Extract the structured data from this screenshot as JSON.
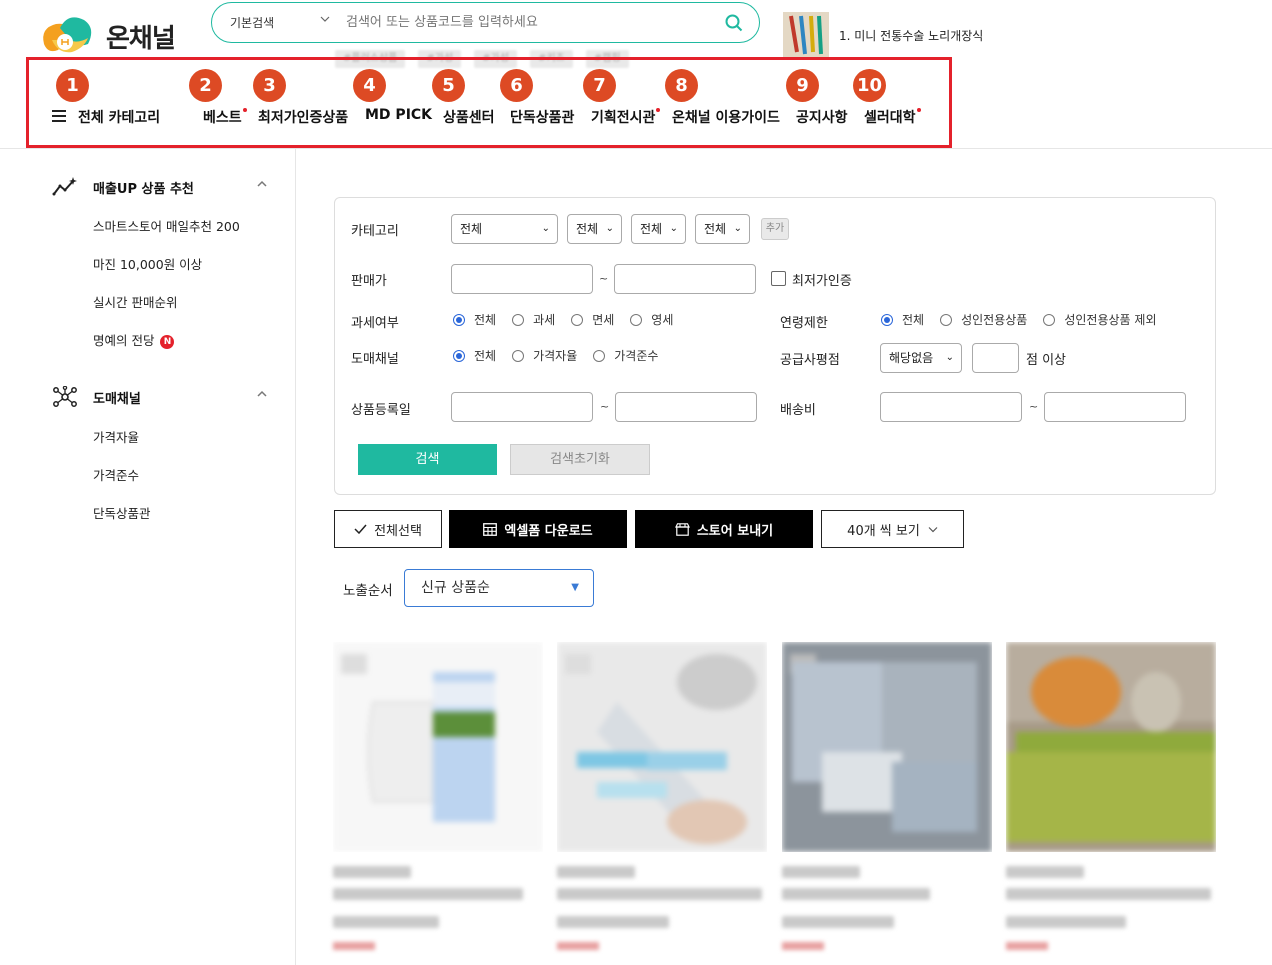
{
  "brand": {
    "name": "온채널"
  },
  "search": {
    "type_label": "기본검색",
    "placeholder": "검색어 또는 상품코드를 입력하세요"
  },
  "tags": [
    "#플러스상품",
    "#가성",
    "#가성",
    "#키즈",
    "#캠핑"
  ],
  "promo": {
    "text": "1. 미니 전통수술 노리개장식"
  },
  "nav": {
    "badges": [
      "1",
      "2",
      "3",
      "4",
      "5",
      "6",
      "7",
      "8",
      "9",
      "10"
    ],
    "items": [
      {
        "label": "전체 카테고리"
      },
      {
        "label": "베스트"
      },
      {
        "label": "최저가인증상품"
      },
      {
        "label": "MD PICK"
      },
      {
        "label": "상품센터"
      },
      {
        "label": "단독상품관"
      },
      {
        "label": "기획전시관"
      },
      {
        "label": "온채널 이용가이드"
      },
      {
        "label": "공지사항"
      },
      {
        "label": "셀러대학"
      }
    ]
  },
  "sidebar": {
    "section1": {
      "title": "매출UP 상품 추천",
      "links": [
        "스마트스토어 매일추천 200",
        "마진 10,000원 이상",
        "실시간 판매순위",
        "명예의 전당"
      ],
      "new_badge": "N"
    },
    "section2": {
      "title": "도매채널",
      "links": [
        "가격자율",
        "가격준수",
        "단독상품관"
      ]
    }
  },
  "filter": {
    "category_label": "카테고리",
    "category_selects": [
      "전체",
      "전체",
      "전체",
      "전체"
    ],
    "add_label": "추가",
    "price_label": "판매가",
    "tilde": "~",
    "lowest_label": "최저가인증",
    "tax_label": "과세여부",
    "tax_options": [
      "전체",
      "과세",
      "면세",
      "영세"
    ],
    "age_label": "연령제한",
    "age_options": [
      "전체",
      "성인전용상품",
      "성인전용상품 제외"
    ],
    "channel_label": "도매채널",
    "channel_options": [
      "전체",
      "가격자율",
      "가격준수"
    ],
    "rating_label": "공급사평점",
    "rating_select": "해당없음",
    "rating_suffix": "점 이상",
    "date_label": "상품등록일",
    "ship_label": "배송비",
    "search_btn": "검색",
    "reset_btn": "검색초기화"
  },
  "actions": {
    "select_all": "전체선택",
    "excel": "엑셀폼 다운로드",
    "send_store": "스토어 보내기",
    "per_page": "40개 씩 보기"
  },
  "sort": {
    "label": "노출순서",
    "value": "신규 상품순"
  },
  "colors": {
    "accent": "#1fb9a0",
    "highlight": "#e4212b",
    "badge": "#dd4a24"
  }
}
